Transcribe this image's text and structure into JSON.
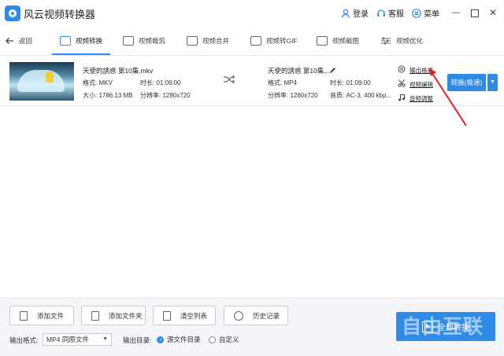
{
  "app": {
    "title": "风云视频转换器",
    "logo_icon": "app-logo-icon"
  },
  "titlebar": {
    "login": "登录",
    "service": "客服",
    "menu": "菜单",
    "accent": "#2f8be8"
  },
  "nav": {
    "back": "返回",
    "tabs": [
      {
        "label": "视频转换",
        "icon": "video-convert-icon",
        "active": true
      },
      {
        "label": "视频裁剪",
        "icon": "video-crop-icon"
      },
      {
        "label": "视频合并",
        "icon": "video-merge-icon"
      },
      {
        "label": "视频转GIF",
        "icon": "gif-icon"
      },
      {
        "label": "视频截图",
        "icon": "screenshot-icon"
      },
      {
        "label": "视频优化",
        "icon": "optimize-icon"
      }
    ]
  },
  "file": {
    "source": {
      "name": "天使的誘惑 第10集.mkv",
      "format": "格式: MKV",
      "duration": "时长: 01:09:00",
      "size": "大小: 1786.13 MB",
      "resolution": "分辨率: 1280x720"
    },
    "target": {
      "name": "天使的誘惑 第10集...",
      "format": "格式: MP4",
      "duration": "时长: 01:09:00",
      "resolution": "分辨率: 1280x720",
      "audio": "音质: AC-3, 400 kbp..."
    },
    "options": {
      "output_format": "输出格式",
      "video_edit": "视频编辑",
      "audio_adjust": "音频调整"
    },
    "convert_button": "转换(极速)"
  },
  "bottom": {
    "add_file": "添加文件",
    "add_folder": "添加文件夹",
    "clear_list": "清空列表",
    "history": "历史记录",
    "output_format_label": "输出格式:",
    "output_format_value": "MP4 同原文件",
    "output_dir_label": "输出目录:",
    "dir_source": "源文件目录",
    "dir_custom": "自定义",
    "convert_all": "全部转换"
  },
  "watermark": "自由互联",
  "annotation_arrow_color": "#e02020"
}
